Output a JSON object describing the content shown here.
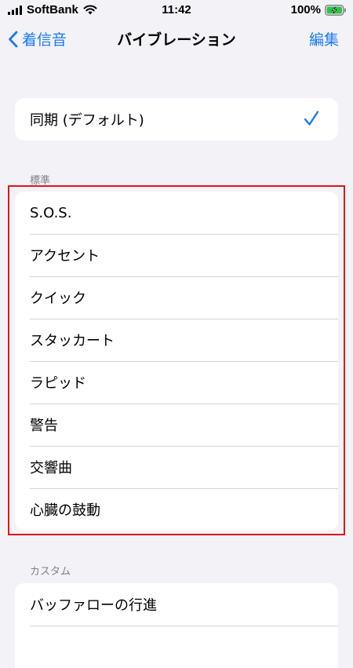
{
  "status_bar": {
    "carrier": "SoftBank",
    "time": "11:42",
    "battery_percent": "100%"
  },
  "nav": {
    "back_label": "着信音",
    "title": "バイブレーション",
    "edit_label": "編集"
  },
  "sync_row": {
    "label": "同期 (デフォルト)",
    "selected": true
  },
  "standard": {
    "header": "標準",
    "items": [
      {
        "label": "S.O.S."
      },
      {
        "label": "アクセント"
      },
      {
        "label": "クイック"
      },
      {
        "label": "スタッカート"
      },
      {
        "label": "ラピッド"
      },
      {
        "label": "警告"
      },
      {
        "label": "交響曲"
      },
      {
        "label": "心臓の鼓動"
      }
    ]
  },
  "custom": {
    "header": "カスタム",
    "items": [
      {
        "label": "バッファローの行進"
      }
    ]
  },
  "colors": {
    "accent": "#1a7bf2",
    "background": "#f2f2f7",
    "highlight_border": "#e3141a"
  }
}
